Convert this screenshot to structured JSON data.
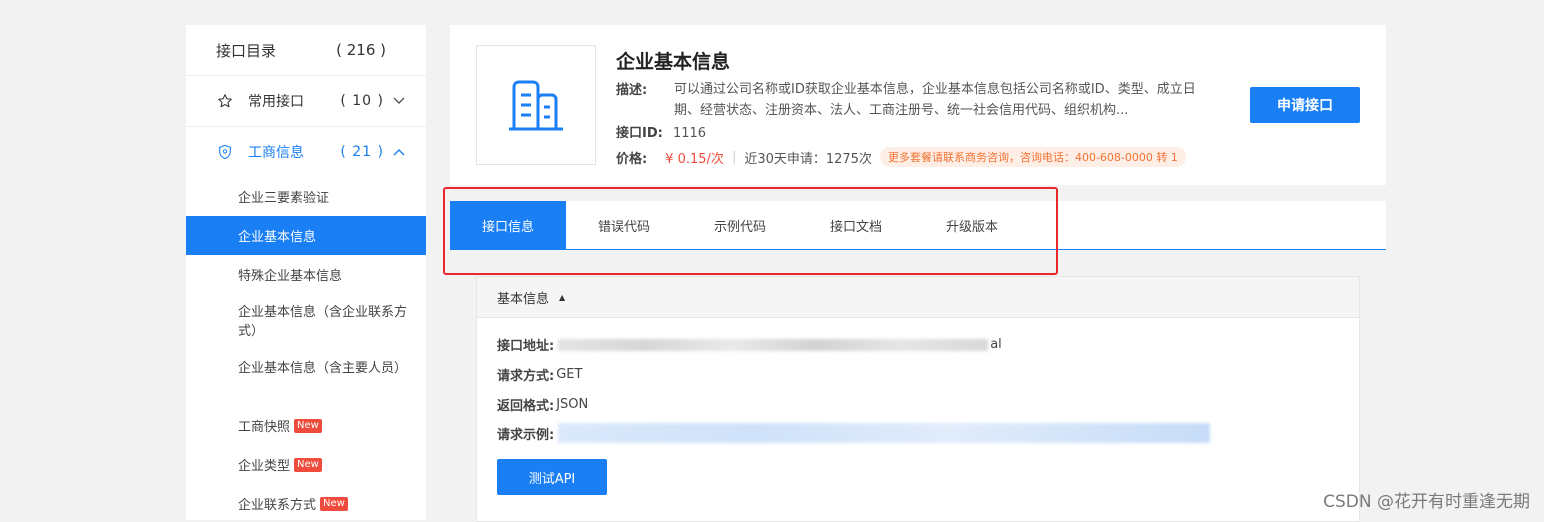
{
  "sidebar": {
    "catalog_label": "接口目录",
    "catalog_count": "( 216 )",
    "groups": [
      {
        "label": "常用接口",
        "count": "( 10 )",
        "icon": "star-icon"
      },
      {
        "label": "工商信息",
        "count": "( 21 )",
        "icon": "shield-icon"
      }
    ],
    "items": [
      {
        "label": "企业三要素验证"
      },
      {
        "label": "企业基本信息"
      },
      {
        "label": "特殊企业基本信息"
      },
      {
        "label": "企业基本信息（含企业联系方式）"
      },
      {
        "label": "企业基本信息（含主要人员）"
      },
      {
        "label": "工商快照",
        "badge": "New"
      },
      {
        "label": "企业类型",
        "badge": "New"
      },
      {
        "label": "企业联系方式",
        "badge": "New"
      }
    ]
  },
  "api": {
    "title": "企业基本信息",
    "desc_label": "描述:",
    "desc_text": "可以通过公司名称或ID获取企业基本信息，企业基本信息包括公司名称或ID、类型、成立日期、经营状态、注册资本、法人、工商注册号、统一社会信用代码、组织机构...",
    "id_label": "接口ID:",
    "id_value": "1116",
    "price_label": "价格:",
    "price_value": "¥ 0.15/次",
    "apply_count": "近30天申请：1275次",
    "promo": "更多套餐请联系商务咨询，咨询电话：400-608-0000 转 1",
    "apply_button": "申请接口"
  },
  "tabs": [
    {
      "label": "接口信息",
      "active": true
    },
    {
      "label": "错误代码",
      "active": false
    },
    {
      "label": "示例代码",
      "active": false
    },
    {
      "label": "接口文档",
      "active": false
    },
    {
      "label": "升级版本",
      "active": false
    }
  ],
  "panel": {
    "header": "基本信息",
    "address_label": "接口地址:",
    "address_tail": "al",
    "method_label": "请求方式:",
    "method_value": "GET",
    "format_label": "返回格式:",
    "format_value": "JSON",
    "example_label": "请求示例:",
    "test_button": "测试API"
  },
  "watermark": "CSDN @花开有时重逢无期",
  "colors": {
    "accent": "#1a7ff4",
    "price": "#f04c3d",
    "promo_text": "#f47234",
    "highlight_frame": "#e8282d"
  }
}
